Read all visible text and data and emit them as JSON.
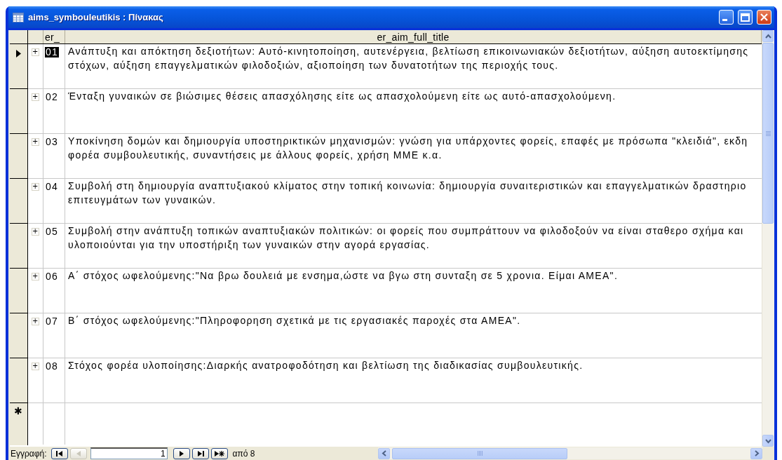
{
  "window": {
    "title": "aims_symbouleutikis : Πίνακας"
  },
  "table": {
    "columns": [
      "er_",
      "er_aim_full_title"
    ],
    "rows": [
      {
        "selected": true,
        "expander": "+",
        "id": "01",
        "lines": [
          "Ανάπτυξη και απόκτηση δεξιοτήτων: Αυτό-κινητοποίηση, αυτενέργεια, βελτίωση επικοινωνιακών δεξιοτήτων, αύξηση αυτοεκτίμησης",
          "στόχων, αύξηση επαγγελματικών φιλοδοξιών, αξιοποίηση των δυνατοτήτων της περιοχής τους."
        ]
      },
      {
        "selected": false,
        "expander": "+",
        "id": "02",
        "lines": [
          "Ένταξη γυναικών σε βιώσιμες θέσεις απασχόλησης είτε ως απασχολούμενη είτε ως αυτό-απασχολούμενη."
        ]
      },
      {
        "selected": false,
        "expander": "+",
        "id": "03",
        "lines": [
          "Υποκίνηση δομών και δημιουργία υποστηρικτικών μηχανισμών: γνώση για υπάρχοντες φορείς, επαφές με πρόσωπα \"κλειδιά\", εκδη",
          "φορέα συμβουλευτικής, συναντήσεις με άλλους φορείς, χρήση ΜΜΕ κ.α."
        ]
      },
      {
        "selected": false,
        "expander": "+",
        "id": "04",
        "lines": [
          "Συμβολή στη δημιουργία αναπτυξιακού κλίματος στην τοπική κοινωνία: δημιουργία συναιτεριστικών και επαγγελματικών δραστηριο",
          "επιτευγμάτων των γυναικών."
        ]
      },
      {
        "selected": false,
        "expander": "+",
        "id": "05",
        "lines": [
          "Συμβολή στην ανάπτυξη τοπικών αναπτυξιακών πολιτικών: οι φορείς που συμπράττουν να φιλοδοξούν να είναι σταθερο σχήμα και",
          "υλοποιούνται για την υποστήριξη των γυναικών στην αγορά εργασίας."
        ]
      },
      {
        "selected": false,
        "expander": "+",
        "id": "06",
        "lines": [
          "Α΄ στόχος ωφελούμενης:\"Να βρω δουλειά με ενσημα,ώστε να βγω στη συνταξη σε 5 χρονια. Είμαι ΑΜΕΑ\"."
        ]
      },
      {
        "selected": false,
        "expander": "+",
        "id": "07",
        "lines": [
          "Β΄ στόχος ωφελούμενης:\"Πληροφορηση σχετικά με τις εργασιακές παροχές στα ΑΜΕΑ\"."
        ]
      },
      {
        "selected": false,
        "expander": "+",
        "id": "08",
        "lines": [
          "Στόχος φορέα υλοποίησης:Διαρκής ανατροφοδότηση και βελτίωση της διαδικασίας συμβουλευτικής."
        ]
      }
    ],
    "new_record_marker": "✱"
  },
  "record_nav": {
    "label": "Εγγραφή:",
    "current": "1",
    "total": "από 8",
    "buttons": [
      {
        "kind": "first",
        "disabled": false
      },
      {
        "kind": "prev",
        "disabled": true
      },
      {
        "kind": "next",
        "disabled": false
      },
      {
        "kind": "last",
        "disabled": false
      },
      {
        "kind": "new",
        "disabled": false
      }
    ]
  }
}
